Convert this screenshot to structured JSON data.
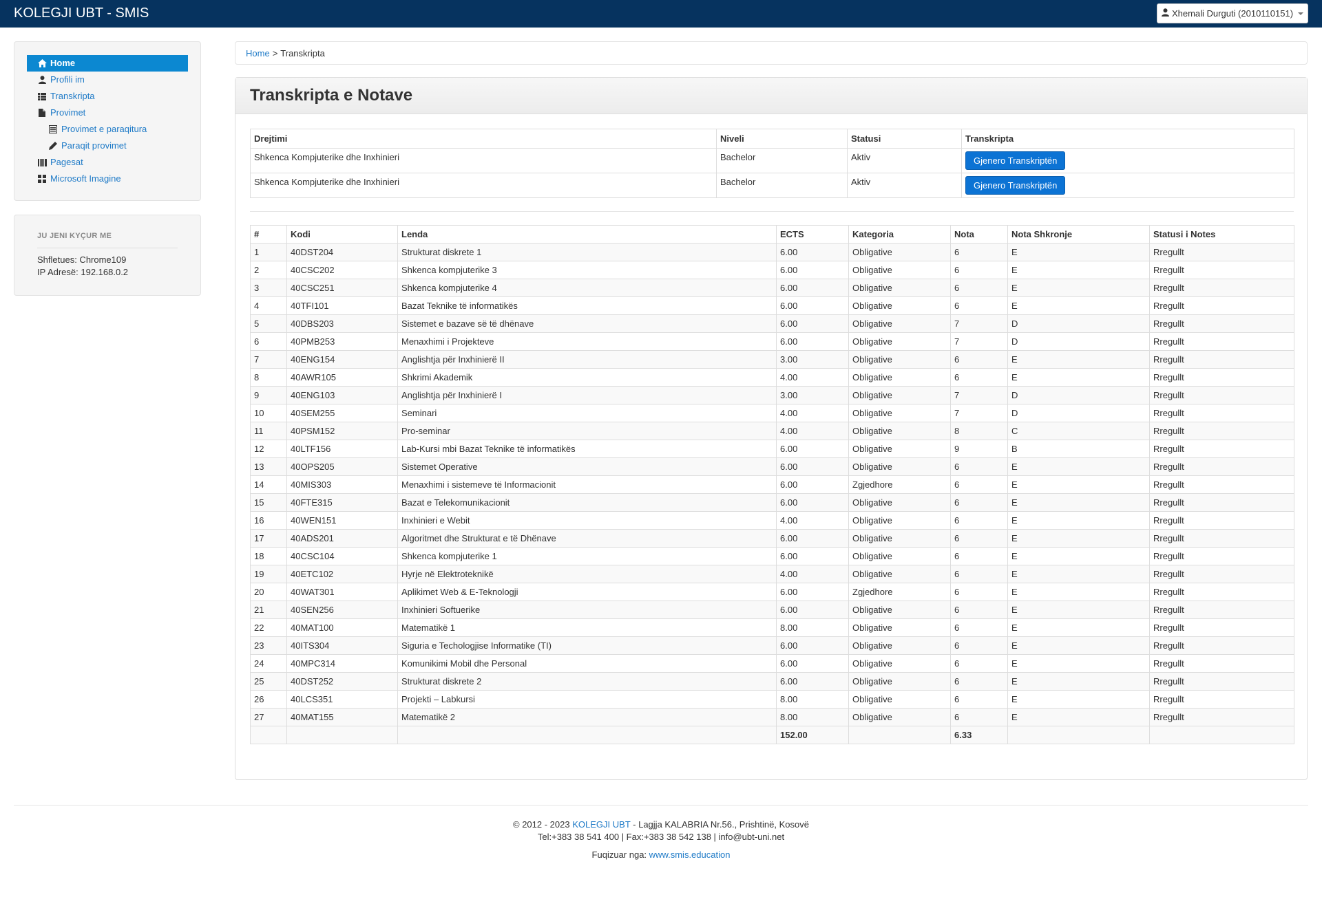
{
  "navbar": {
    "brand": "KOLEGJI UBT - SMIS",
    "user": "Xhemali Durguti (2010110151)"
  },
  "sidebar": {
    "items": [
      {
        "label": "Home",
        "icon": "home-icon"
      },
      {
        "label": "Profili im",
        "icon": "user-icon"
      },
      {
        "label": "Transkripta",
        "icon": "list-icon"
      },
      {
        "label": "Provimet",
        "icon": "file-icon"
      },
      {
        "label": "Provimet e paraqitura",
        "icon": "list-alt-icon"
      },
      {
        "label": "Paraqit provimet",
        "icon": "pencil-icon"
      },
      {
        "label": "Pagesat",
        "icon": "barcode-icon"
      },
      {
        "label": "Microsoft Imagine",
        "icon": "grid-icon"
      }
    ]
  },
  "session": {
    "title": "JU JENI KYÇUR ME",
    "browser": "Shfletues: Chrome109",
    "ip": "IP Adresë: 192.168.0.2"
  },
  "breadcrumb": {
    "home": "Home",
    "separator": ">",
    "current": "Transkripta"
  },
  "panel": {
    "title": "Transkripta e Notave"
  },
  "programs": {
    "headers": [
      "Drejtimi",
      "Niveli",
      "Statusi",
      "Transkripta"
    ],
    "rows": [
      {
        "drejtimi": "Shkenca Kompjuterike dhe Inxhinieri",
        "niveli": "Bachelor",
        "statusi": "Aktiv",
        "button": "Gjenero Transkriptën"
      },
      {
        "drejtimi": "Shkenca Kompjuterike dhe Inxhinieri",
        "niveli": "Bachelor",
        "statusi": "Aktiv",
        "button": "Gjenero Transkriptën"
      }
    ]
  },
  "grades": {
    "headers": [
      "#",
      "Kodi",
      "Lenda",
      "ECTS",
      "Kategoria",
      "Nota",
      "Nota Shkronje",
      "Statusi i Notes"
    ],
    "rows": [
      [
        "1",
        "40DST204",
        "Strukturat diskrete 1",
        "6.00",
        "Obligative",
        "6",
        "E",
        "Rregullt"
      ],
      [
        "2",
        "40CSC202",
        "Shkenca kompjuterike 3",
        "6.00",
        "Obligative",
        "6",
        "E",
        "Rregullt"
      ],
      [
        "3",
        "40CSC251",
        "Shkenca kompjuterike 4",
        "6.00",
        "Obligative",
        "6",
        "E",
        "Rregullt"
      ],
      [
        "4",
        "40TFI101",
        "Bazat Teknike të informatikës",
        "6.00",
        "Obligative",
        "6",
        "E",
        "Rregullt"
      ],
      [
        "5",
        "40DBS203",
        "Sistemet e bazave së të dhënave",
        "6.00",
        "Obligative",
        "7",
        "D",
        "Rregullt"
      ],
      [
        "6",
        "40PMB253",
        "Menaxhimi i Projekteve",
        "6.00",
        "Obligative",
        "7",
        "D",
        "Rregullt"
      ],
      [
        "7",
        "40ENG154",
        "Anglishtja për Inxhinierë II",
        "3.00",
        "Obligative",
        "6",
        "E",
        "Rregullt"
      ],
      [
        "8",
        "40AWR105",
        "Shkrimi Akademik",
        "4.00",
        "Obligative",
        "6",
        "E",
        "Rregullt"
      ],
      [
        "9",
        "40ENG103",
        "Anglishtja për Inxhinierë I",
        "3.00",
        "Obligative",
        "7",
        "D",
        "Rregullt"
      ],
      [
        "10",
        "40SEM255",
        "Seminari",
        "4.00",
        "Obligative",
        "7",
        "D",
        "Rregullt"
      ],
      [
        "11",
        "40PSM152",
        "Pro-seminar",
        "4.00",
        "Obligative",
        "8",
        "C",
        "Rregullt"
      ],
      [
        "12",
        "40LTF156",
        "Lab-Kursi mbi Bazat Teknike të informatikës",
        "6.00",
        "Obligative",
        "9",
        "B",
        "Rregullt"
      ],
      [
        "13",
        "40OPS205",
        "Sistemet Operative",
        "6.00",
        "Obligative",
        "6",
        "E",
        "Rregullt"
      ],
      [
        "14",
        "40MIS303",
        "Menaxhimi i sistemeve të Informacionit",
        "6.00",
        "Zgjedhore",
        "6",
        "E",
        "Rregullt"
      ],
      [
        "15",
        "40FTE315",
        "Bazat e Telekomunikacionit",
        "6.00",
        "Obligative",
        "6",
        "E",
        "Rregullt"
      ],
      [
        "16",
        "40WEN151",
        "Inxhinieri e Webit",
        "4.00",
        "Obligative",
        "6",
        "E",
        "Rregullt"
      ],
      [
        "17",
        "40ADS201",
        "Algoritmet dhe Strukturat e të Dhënave",
        "6.00",
        "Obligative",
        "6",
        "E",
        "Rregullt"
      ],
      [
        "18",
        "40CSC104",
        "Shkenca kompjuterike 1",
        "6.00",
        "Obligative",
        "6",
        "E",
        "Rregullt"
      ],
      [
        "19",
        "40ETC102",
        "Hyrje në Elektroteknikë",
        "4.00",
        "Obligative",
        "6",
        "E",
        "Rregullt"
      ],
      [
        "20",
        "40WAT301",
        "Aplikimet Web & E-Teknologji",
        "6.00",
        "Zgjedhore",
        "6",
        "E",
        "Rregullt"
      ],
      [
        "21",
        "40SEN256",
        "Inxhinieri Softuerike",
        "6.00",
        "Obligative",
        "6",
        "E",
        "Rregullt"
      ],
      [
        "22",
        "40MAT100",
        "Matematikë 1",
        "8.00",
        "Obligative",
        "6",
        "E",
        "Rregullt"
      ],
      [
        "23",
        "40ITS304",
        "Siguria e Techologjise Informatike (TI)",
        "6.00",
        "Obligative",
        "6",
        "E",
        "Rregullt"
      ],
      [
        "24",
        "40MPC314",
        "Komunikimi Mobil dhe Personal",
        "6.00",
        "Obligative",
        "6",
        "E",
        "Rregullt"
      ],
      [
        "25",
        "40DST252",
        "Strukturat diskrete 2",
        "6.00",
        "Obligative",
        "6",
        "E",
        "Rregullt"
      ],
      [
        "26",
        "40LCS351",
        "Projekti – Labkursi",
        "8.00",
        "Obligative",
        "6",
        "E",
        "Rregullt"
      ],
      [
        "27",
        "40MAT155",
        "Matematikë 2",
        "8.00",
        "Obligative",
        "6",
        "E",
        "Rregullt"
      ]
    ],
    "total_ects": "152.00",
    "average": "6.33"
  },
  "footer": {
    "copyright_pre": "© 2012 - 2023",
    "org_link": "KOLEGJI UBT",
    "address": "- Lagjja KALABRIA Nr.56., Prishtinë, Kosovë",
    "contact": "Tel:+383 38 541 400 | Fax:+383 38 542 138 | info@ubt-uni.net",
    "powered_label": "Fuqizuar nga:",
    "powered_link": "www.smis.education"
  },
  "colors": {
    "navbar": "#06335f",
    "accent": "#0c88d1",
    "button": "#0c73d4",
    "link": "#1e7ac7"
  }
}
